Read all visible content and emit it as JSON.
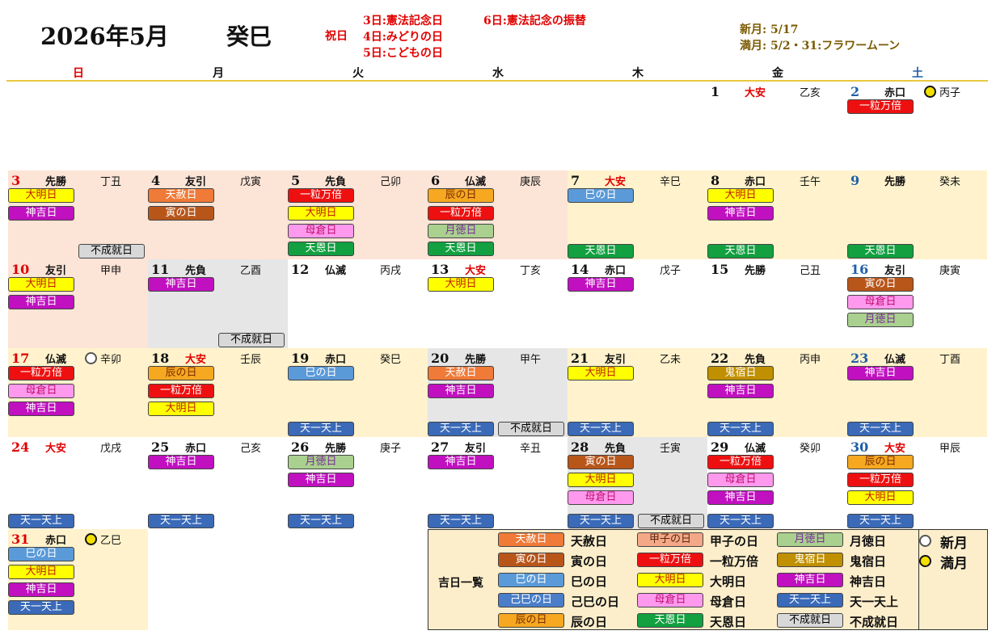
{
  "header": {
    "title": "2026年5月",
    "kanshi": "癸巳",
    "holiday_label": "祝日",
    "holidays": [
      "3日:憲法記念日",
      "6日:憲法記念の振替",
      "4日:みどりの日",
      "5日:こどもの日"
    ],
    "new_moon": "新月:  5/17",
    "full_moon": "満月:  5/2・31:フラワームーン"
  },
  "weekdays": [
    "日",
    "月",
    "火",
    "水",
    "木",
    "金",
    "土"
  ],
  "colors": {
    "sunday": "#e00000",
    "saturday": "#1f5fa8",
    "weekday": "#111111",
    "divider": "#e8c840"
  },
  "tags": {
    "天赦日": {
      "bg": "#f07a38",
      "fg": "#ffffff"
    },
    "寅の日": {
      "bg": "#b8561a",
      "fg": "#ffffff"
    },
    "巳の日": {
      "bg": "#5a9ad8",
      "fg": "#ffffff"
    },
    "己巳の日": {
      "bg": "#4a7ec8",
      "fg": "#ffffff"
    },
    "辰の日": {
      "bg": "#f5a820",
      "fg": "#7a2b00"
    },
    "甲子の日": {
      "bg": "#f5a888",
      "fg": "#5a2a10"
    },
    "一粒万倍": {
      "bg": "#ee1010",
      "fg": "#ffffff"
    },
    "大明日": {
      "bg": "#ffff00",
      "fg": "#c02000"
    },
    "母倉日": {
      "bg": "#ff99ee",
      "fg": "#c01070"
    },
    "天恩日": {
      "bg": "#12a040",
      "fg": "#ffffff"
    },
    "月徳日": {
      "bg": "#a9d08e",
      "fg": "#7a2a9a"
    },
    "鬼宿日": {
      "bg": "#c09000",
      "fg": "#ffffff"
    },
    "神吉日": {
      "bg": "#c010c0",
      "fg": "#ffffff"
    },
    "天一天上": {
      "bg": "#3a6ab8",
      "fg": "#ffffff"
    },
    "不成就日": {
      "bg": "#d8d8d8",
      "fg": "#000000"
    }
  },
  "days": [
    {
      "day": 1,
      "rokuyo": "大安",
      "kanshi": "乙亥",
      "bg": "#ffffff",
      "tags": [],
      "bottom": []
    },
    {
      "day": 2,
      "rokuyo": "赤口",
      "kanshi": "丙子",
      "bg": "#ffffff",
      "moon": "full",
      "tags": [
        "一粒万倍"
      ],
      "bottom": []
    },
    {
      "day": 3,
      "rokuyo": "先勝",
      "kanshi": "丁丑",
      "bg": "#fce4d6",
      "tags": [
        "大明日",
        "神吉日"
      ],
      "bottom": []
    },
    {
      "day": 4,
      "rokuyo": "友引",
      "kanshi": "戊寅",
      "bg": "#fce4d6",
      "tags": [
        "天赦日",
        "寅の日"
      ],
      "bottom": []
    },
    {
      "day": 5,
      "rokuyo": "先負",
      "kanshi": "己卯",
      "bg": "#fce4d6",
      "tags": [
        "一粒万倍",
        "大明日",
        "母倉日",
        "天恩日"
      ],
      "bottom": []
    },
    {
      "day": 6,
      "rokuyo": "仏滅",
      "kanshi": "庚辰",
      "bg": "#fce4d6",
      "tags": [
        "辰の日",
        "一粒万倍",
        "月徳日",
        "天恩日"
      ],
      "bottom": []
    },
    {
      "day": 7,
      "rokuyo": "大安",
      "kanshi": "辛巳",
      "bg": "#fff2cc",
      "tags": [
        "巳の日"
      ],
      "bottom": [
        "天恩日"
      ]
    },
    {
      "day": 8,
      "rokuyo": "赤口",
      "kanshi": "壬午",
      "bg": "#fff2cc",
      "tags": [
        "大明日",
        "神吉日"
      ],
      "bottom": [
        "天恩日"
      ]
    },
    {
      "day": 9,
      "rokuyo": "先勝",
      "kanshi": "癸未",
      "bg": "#fff2cc",
      "tags": [],
      "bottom": [
        "天恩日"
      ]
    },
    {
      "day": 10,
      "rokuyo": "友引",
      "kanshi": "甲申",
      "bg": "#fce4d6",
      "tags": [
        "大明日",
        "神吉日"
      ],
      "bottom": []
    },
    {
      "day": 11,
      "rokuyo": "先負",
      "kanshi": "乙酉",
      "bg": "#e6e6e6",
      "tags": [
        "神吉日"
      ],
      "bottom": []
    },
    {
      "day": 12,
      "rokuyo": "仏滅",
      "kanshi": "丙戌",
      "bg": "#ffffff",
      "tags": [],
      "bottom": []
    },
    {
      "day": 13,
      "rokuyo": "大安",
      "kanshi": "丁亥",
      "bg": "#ffffff",
      "tags": [
        "大明日"
      ],
      "bottom": []
    },
    {
      "day": 14,
      "rokuyo": "赤口",
      "kanshi": "戊子",
      "bg": "#ffffff",
      "tags": [
        "神吉日"
      ],
      "bottom": []
    },
    {
      "day": 15,
      "rokuyo": "先勝",
      "kanshi": "己丑",
      "bg": "#ffffff",
      "tags": [],
      "bottom": []
    },
    {
      "day": 16,
      "rokuyo": "友引",
      "kanshi": "庚寅",
      "bg": "#ffffff",
      "tags": [
        "寅の日",
        "母倉日",
        "月徳日"
      ],
      "bottom": []
    },
    {
      "day": 17,
      "rokuyo": "仏滅",
      "kanshi": "辛卯",
      "bg": "#fff2cc",
      "moon": "new",
      "tags": [
        "一粒万倍",
        "母倉日",
        "神吉日"
      ],
      "bottom": []
    },
    {
      "day": 18,
      "rokuyo": "大安",
      "kanshi": "壬辰",
      "bg": "#fff2cc",
      "tags": [
        "辰の日",
        "一粒万倍",
        "大明日"
      ],
      "bottom": []
    },
    {
      "day": 19,
      "rokuyo": "赤口",
      "kanshi": "癸巳",
      "bg": "#fff2cc",
      "tags": [
        "巳の日"
      ],
      "bottom": [
        "天一天上"
      ]
    },
    {
      "day": 20,
      "rokuyo": "先勝",
      "kanshi": "甲午",
      "bg": "#e6e6e6",
      "tags": [
        "天赦日",
        "神吉日"
      ],
      "bottom": [
        "天一天上"
      ]
    },
    {
      "day": 21,
      "rokuyo": "友引",
      "kanshi": "乙未",
      "bg": "#fff2cc",
      "tags": [
        "大明日"
      ],
      "bottom": [
        "天一天上"
      ]
    },
    {
      "day": 22,
      "rokuyo": "先負",
      "kanshi": "丙申",
      "bg": "#fff2cc",
      "tags": [
        "鬼宿日",
        "神吉日"
      ],
      "bottom": [
        "天一天上"
      ]
    },
    {
      "day": 23,
      "rokuyo": "仏滅",
      "kanshi": "丁酉",
      "bg": "#fff2cc",
      "tags": [
        "神吉日"
      ],
      "bottom": [
        "天一天上"
      ]
    },
    {
      "day": 24,
      "rokuyo": "大安",
      "kanshi": "戊戌",
      "bg": "#ffffff",
      "tags": [],
      "bottom": [
        "天一天上"
      ]
    },
    {
      "day": 25,
      "rokuyo": "赤口",
      "kanshi": "己亥",
      "bg": "#ffffff",
      "tags": [
        "神吉日"
      ],
      "bottom": [
        "天一天上"
      ]
    },
    {
      "day": 26,
      "rokuyo": "先勝",
      "kanshi": "庚子",
      "bg": "#ffffff",
      "tags": [
        "月徳日",
        "神吉日"
      ],
      "bottom": [
        "天一天上"
      ]
    },
    {
      "day": 27,
      "rokuyo": "友引",
      "kanshi": "辛丑",
      "bg": "#ffffff",
      "tags": [
        "神吉日"
      ],
      "bottom": [
        "天一天上"
      ]
    },
    {
      "day": 28,
      "rokuyo": "先負",
      "kanshi": "壬寅",
      "bg": "#e6e6e6",
      "tags": [
        "寅の日",
        "大明日",
        "母倉日"
      ],
      "bottom": [
        "天一天上"
      ]
    },
    {
      "day": 29,
      "rokuyo": "仏滅",
      "kanshi": "癸卯",
      "bg": "#ffffff",
      "tags": [
        "一粒万倍",
        "母倉日",
        "神吉日"
      ],
      "bottom": [
        "天一天上"
      ]
    },
    {
      "day": 30,
      "rokuyo": "大安",
      "kanshi": "甲辰",
      "bg": "#ffffff",
      "tags": [
        "辰の日",
        "一粒万倍",
        "大明日"
      ],
      "bottom": [
        "天一天上"
      ]
    },
    {
      "day": 31,
      "rokuyo": "赤口",
      "kanshi": "乙巳",
      "bg": "#fff2cc",
      "moon": "full",
      "tags": [
        "巳の日",
        "大明日",
        "神吉日",
        "天一天上"
      ],
      "bottom": []
    }
  ],
  "fujoju_days": [
    3,
    11,
    20,
    28
  ],
  "fujoju_label": "不成就日",
  "legend": {
    "title": "吉日一覧",
    "items": [
      {
        "tag": "天赦日",
        "name": "天赦日"
      },
      {
        "tag": "寅の日",
        "name": "寅の日"
      },
      {
        "tag": "巳の日",
        "name": "巳の日"
      },
      {
        "tag": "己巳の日",
        "name": "己巳の日"
      },
      {
        "tag": "辰の日",
        "name": "辰の日"
      },
      {
        "tag": "甲子の日",
        "name": "甲子の日"
      },
      {
        "tag": "一粒万倍",
        "name": "一粒万倍"
      },
      {
        "tag": "大明日",
        "name": "大明日"
      },
      {
        "tag": "母倉日",
        "name": "母倉日"
      },
      {
        "tag": "天恩日",
        "name": "天恩日"
      },
      {
        "tag": "月徳日",
        "name": "月徳日"
      },
      {
        "tag": "鬼宿日",
        "name": "鬼宿日"
      },
      {
        "tag": "神吉日",
        "name": "神吉日"
      },
      {
        "tag": "天一天上",
        "name": "天一天上"
      },
      {
        "tag": "不成就日",
        "name": "不成就日"
      }
    ],
    "moons": [
      {
        "type": "new",
        "name": "新月"
      },
      {
        "type": "full",
        "name": "満月"
      }
    ]
  }
}
